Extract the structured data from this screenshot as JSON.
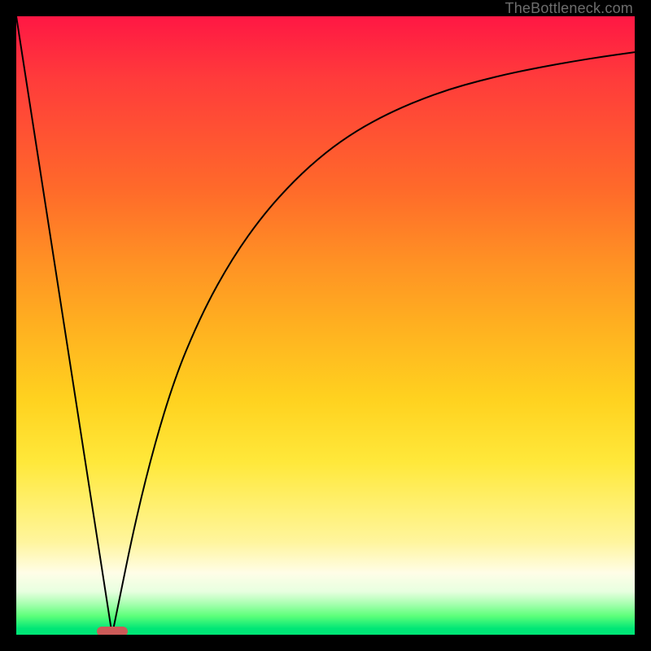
{
  "watermark": "TheBottleneck.com",
  "chart_data": {
    "type": "line",
    "title": "",
    "xlabel": "",
    "ylabel": "",
    "xlim": [
      0,
      100
    ],
    "ylim": [
      0,
      100
    ],
    "grid": false,
    "legend": false,
    "series": [
      {
        "name": "left-branch",
        "x": [
          0,
          15.5
        ],
        "values": [
          100,
          0
        ]
      },
      {
        "name": "right-branch",
        "x": [
          15.5,
          20,
          25,
          30,
          35,
          40,
          45,
          50,
          55,
          60,
          65,
          70,
          75,
          80,
          85,
          90,
          95,
          100
        ],
        "values": [
          0,
          22,
          40,
          52,
          61,
          68,
          73.5,
          78,
          81.5,
          84.2,
          86.4,
          88.2,
          89.6,
          90.8,
          91.8,
          92.7,
          93.5,
          94.2
        ]
      }
    ],
    "marker": {
      "x": 15.5,
      "y": 0,
      "color": "#cc5a58"
    },
    "background_gradient": {
      "top": "#ff1744",
      "middle": "#ffe83a",
      "bottom": "#00e676"
    }
  }
}
